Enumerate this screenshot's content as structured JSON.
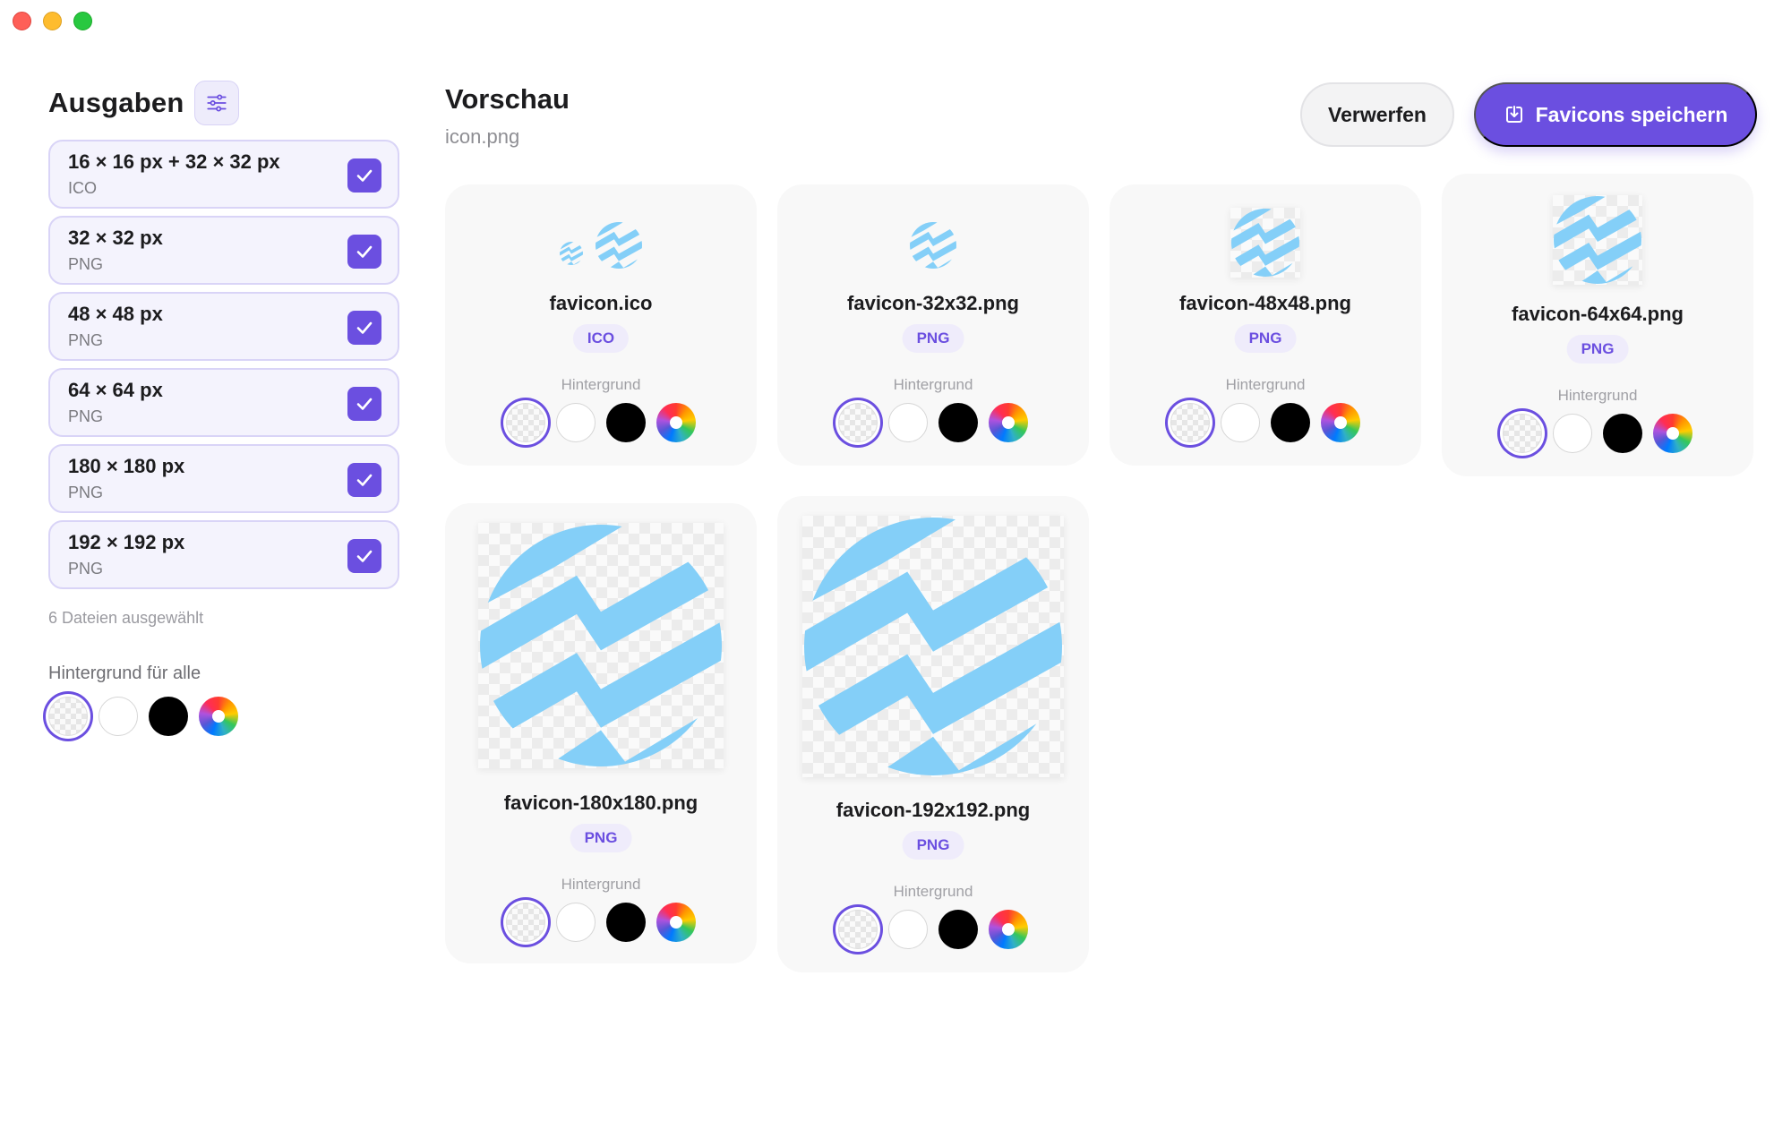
{
  "window": {
    "buttons": [
      "close",
      "minimize",
      "maximize"
    ]
  },
  "sidebar": {
    "title": "Ausgaben",
    "filter_icon": "sliders-icon",
    "outputs": [
      {
        "size": "16 × 16 px + 32 × 32 px",
        "format": "ICO",
        "checked": true
      },
      {
        "size": "32 × 32 px",
        "format": "PNG",
        "checked": true
      },
      {
        "size": "48 × 48 px",
        "format": "PNG",
        "checked": true
      },
      {
        "size": "64 × 64 px",
        "format": "PNG",
        "checked": true
      },
      {
        "size": "180 × 180 px",
        "format": "PNG",
        "checked": true
      },
      {
        "size": "192 × 192 px",
        "format": "PNG",
        "checked": true
      }
    ],
    "selected_count": "6 Dateien ausgewählt",
    "bg_all_label": "Hintergrund für alle",
    "bg_selected": "transparent"
  },
  "preview": {
    "title": "Vorschau",
    "source_file": "icon.png"
  },
  "actions": {
    "discard": "Verwerfen",
    "save": "Favicons speichern",
    "save_icon": "download-icon"
  },
  "cards": [
    {
      "filename": "favicon.ico",
      "badge": "ICO",
      "bg_label": "Hintergrund",
      "bg_selected": "transparent"
    },
    {
      "filename": "favicon-32x32.png",
      "badge": "PNG",
      "bg_label": "Hintergrund",
      "bg_selected": "transparent"
    },
    {
      "filename": "favicon-48x48.png",
      "badge": "PNG",
      "bg_label": "Hintergrund",
      "bg_selected": "transparent"
    },
    {
      "filename": "favicon-64x64.png",
      "badge": "PNG",
      "bg_label": "Hintergrund",
      "bg_selected": "transparent"
    },
    {
      "filename": "favicon-180x180.png",
      "badge": "PNG",
      "bg_label": "Hintergrund",
      "bg_selected": "transparent"
    },
    {
      "filename": "favicon-192x192.png",
      "badge": "PNG",
      "bg_label": "Hintergrund",
      "bg_selected": "transparent"
    }
  ],
  "colors": {
    "accent": "#6b4fe0",
    "icon_blue": "#84cff8",
    "card_bg": "#f8f8f8"
  }
}
